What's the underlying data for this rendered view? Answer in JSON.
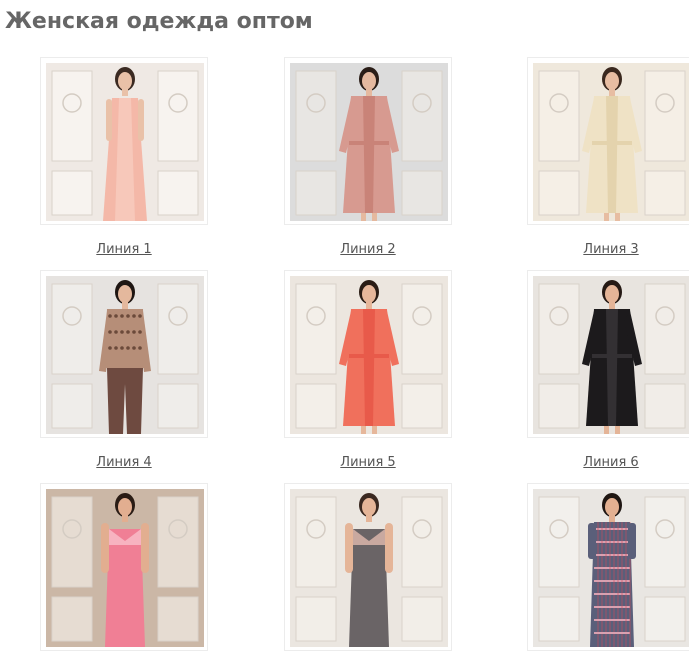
{
  "page": {
    "title": "Женская одежда оптом"
  },
  "products": [
    {
      "caption": "Линия 1",
      "scene": {
        "bg": "#efe9e4",
        "wall": "#f7f3ef",
        "garment": "#f4b8a8",
        "garment2": "#f8cfc2",
        "skin": "#e9c1a8",
        "hair": "#3b2a22",
        "style": "gown"
      }
    },
    {
      "caption": "Линия 2",
      "scene": {
        "bg": "#dcdcdc",
        "wall": "#e8e6e3",
        "garment": "#d79a90",
        "garment2": "#c98378",
        "skin": "#e5b99f",
        "hair": "#2a1d17",
        "style": "robe"
      }
    },
    {
      "caption": "Линия 3",
      "scene": {
        "bg": "#efe8dc",
        "wall": "#f5efe6",
        "garment": "#efe2c5",
        "garment2": "#e4d3ad",
        "skin": "#e7bda2",
        "hair": "#3a281e",
        "style": "robe"
      }
    },
    {
      "caption": "Линия 4",
      "scene": {
        "bg": "#e6e3e0",
        "wall": "#efedea",
        "garment": "#b68e78",
        "garment2": "#6e4a40",
        "skin": "#e4b89d",
        "hair": "#1f1612",
        "style": "pajama"
      }
    },
    {
      "caption": "Линия 5",
      "scene": {
        "bg": "#ece6df",
        "wall": "#f3efe9",
        "garment": "#f0705c",
        "garment2": "#e85a4a",
        "skin": "#e6b79b",
        "hair": "#2a1c15",
        "style": "robe"
      }
    },
    {
      "caption": "Линия 6",
      "scene": {
        "bg": "#e8e4df",
        "wall": "#f1ede8",
        "garment": "#1c1a1c",
        "garment2": "#333033",
        "skin": "#e4b497",
        "hair": "#251914",
        "style": "robe"
      }
    },
    {
      "caption": "",
      "scene": {
        "bg": "#cbb7a6",
        "wall": "#e6dcd2",
        "garment": "#f07f95",
        "garment2": "#f7b3c0",
        "skin": "#e2ae90",
        "hair": "#2a1c15",
        "style": "top"
      }
    },
    {
      "caption": "",
      "scene": {
        "bg": "#ebe6e0",
        "wall": "#f2eee8",
        "garment": "#6a6466",
        "garment2": "#c9a9a0",
        "skin": "#e5b598",
        "hair": "#3a2820",
        "style": "top"
      }
    },
    {
      "caption": "",
      "scene": {
        "bg": "#e9e6e2",
        "wall": "#f2f0ec",
        "garment": "#5a5f7a",
        "garment2": "#d9a0b0",
        "skin": "#e3b091",
        "hair": "#1f1612",
        "style": "shirt"
      }
    }
  ]
}
